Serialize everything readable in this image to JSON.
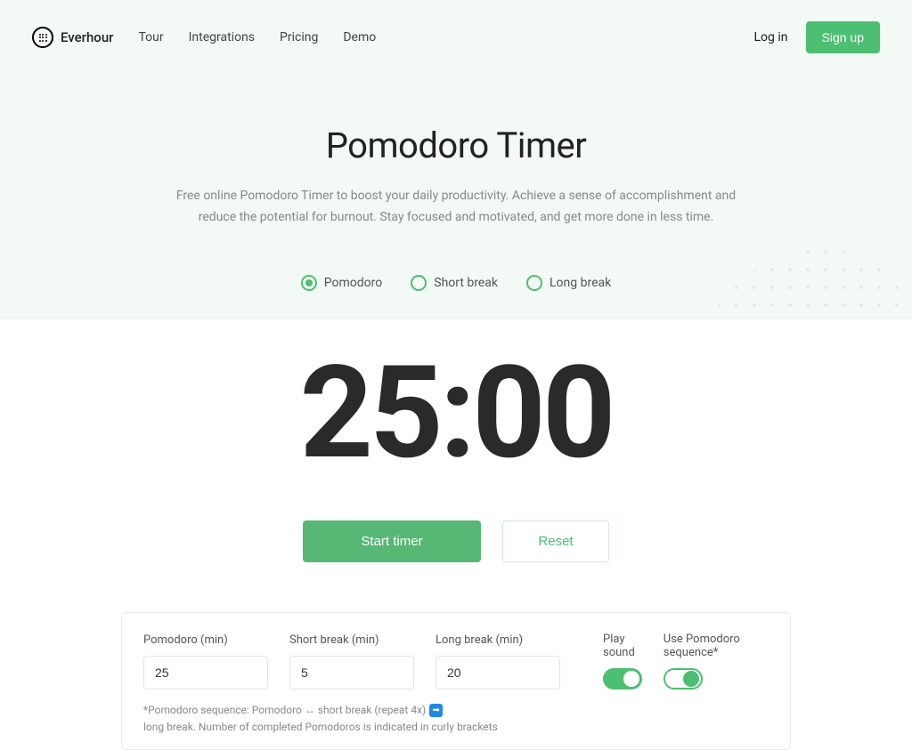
{
  "header": {
    "brand": "Everhour",
    "nav": [
      "Tour",
      "Integrations",
      "Pricing",
      "Demo"
    ],
    "login": "Log in",
    "signup": "Sign up"
  },
  "hero": {
    "title": "Pomodoro Timer",
    "description": "Free online Pomodoro Timer to boost your daily productivity. Achieve a sense of accomplishment and reduce the potential for burnout. Stay focused and motivated, and get more done in less time."
  },
  "tabs": [
    {
      "label": "Pomodoro",
      "active": true
    },
    {
      "label": "Short break",
      "active": false
    },
    {
      "label": "Long break",
      "active": false
    }
  ],
  "timer": {
    "display": "25:00"
  },
  "buttons": {
    "start": "Start timer",
    "reset": "Reset"
  },
  "settings": {
    "pomodoro": {
      "label": "Pomodoro (min)",
      "value": "25"
    },
    "short_break": {
      "label": "Short break (min)",
      "value": "5"
    },
    "long_break": {
      "label": "Long break (min)",
      "value": "20"
    },
    "play_sound": {
      "label": "Play sound",
      "on": true
    },
    "use_sequence": {
      "label": "Use Pomodoro sequence*",
      "on": true
    },
    "footer_prefix": "*Pomodoro sequence: Pomodoro ↔ short break (repeat 4x)",
    "footer_suffix": "long break. Number of completed Pomodoros is indicated in curly brackets"
  }
}
